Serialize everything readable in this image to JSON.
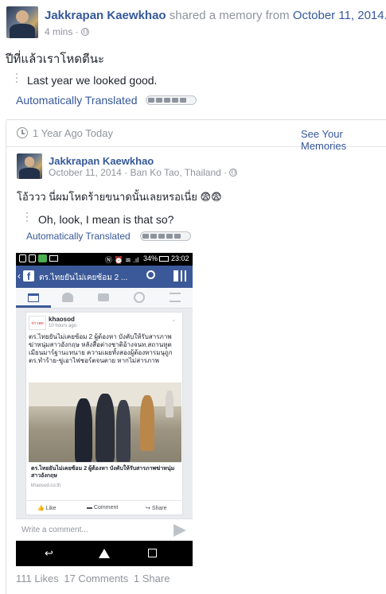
{
  "header": {
    "author": "Jakkrapan Kaewkhao",
    "shared_text": "shared a memory from",
    "memory_date": "October 11, 2014.",
    "time": "4 mins ·",
    "post_text": "ปีที่แล้วเราโหดตีนะ",
    "translation": "Last year we looked good.",
    "auto_translated": "Automatically Translated"
  },
  "memory": {
    "label": "1 Year Ago Today",
    "see_memories": "See Your Memories",
    "author": "Jakkrapan Kaewkhao",
    "date_location": "October 11, 2014 · Ban Ko Tao, Thailand ·",
    "post_text": "โอ้ววว นี่ผมโหดร้ายขนาดนั้นเลยหรอเนี่ย 😨😨",
    "translation": "Oh, look, I mean is that so?",
    "auto_translated": "Automatically Translated"
  },
  "phone": {
    "status_right": "34%",
    "status_time": "23:02",
    "fb_title": "ตร.ไทยยันไม่เคยซ้อม 2 ...",
    "post_source": "khaosod",
    "post_time": "10 hours ago",
    "post_body": "ตร.ไทยยันไม่เคยซ้อม 2 ผู้ต้องหา บังคับให้รับสารภาพฆ่าหนุ่มสาวอังกฤษ หลังสื่อต่างชาติอ้างจนท.สถานทูตเมียนมาร์ฐานะทนาย ความเผยทั้งสองผู้ต้องหารมนุถูกตร.ทำร้าย-ขู่เอาไฟชอร์ตจนตาย หากไม่สารภาพ",
    "link_title": "ตร.ไทยยันไม่เคยซ้อม 2 ผู้ต้องหา บังคับให้รับสารภาพฆ่าหนุ่มสาวอังกฤษ",
    "link_domain": "khaosod.co.th",
    "like": "Like",
    "comment": "Comment",
    "share": "Share",
    "comment_placeholder": "Write a comment..."
  },
  "footer": {
    "likes": "111 Likes",
    "comments": "17 Comments",
    "shares": "1 Share"
  },
  "colors": {
    "link": "#365899",
    "fb_blue": "#3b5998",
    "meta": "#90949c"
  }
}
